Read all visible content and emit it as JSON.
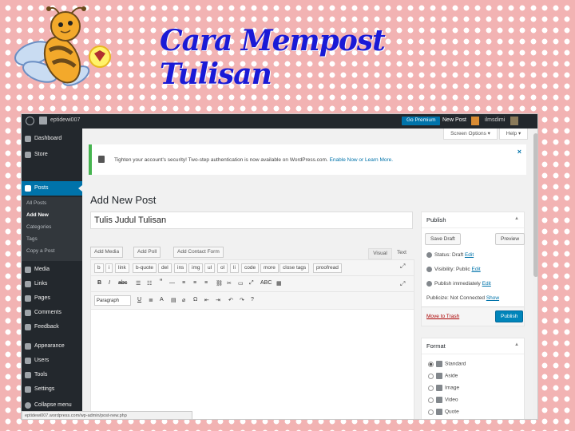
{
  "slide": {
    "title": "Cara Mempost Tulisan"
  },
  "admin_bar": {
    "site_name": "eptidewi007",
    "premium_label": "Go Premium",
    "new_post": "New Post",
    "user": "ilmsdimi"
  },
  "sidebar": {
    "items": [
      {
        "label": "Dashboard",
        "icon": "dashboard-icon"
      },
      {
        "label": "Store",
        "icon": "cart-icon"
      },
      {
        "label": "Posts",
        "icon": "pin-icon"
      },
      {
        "label": "Media",
        "icon": "media-icon"
      },
      {
        "label": "Links",
        "icon": "link-icon"
      },
      {
        "label": "Pages",
        "icon": "pages-icon"
      },
      {
        "label": "Comments",
        "icon": "comment-icon"
      },
      {
        "label": "Feedback",
        "icon": "feedback-icon"
      },
      {
        "label": "Appearance",
        "icon": "brush-icon"
      },
      {
        "label": "Users",
        "icon": "users-icon"
      },
      {
        "label": "Tools",
        "icon": "wrench-icon"
      },
      {
        "label": "Settings",
        "icon": "settings-icon"
      },
      {
        "label": "Collapse menu",
        "icon": "collapse-icon"
      }
    ],
    "posts_submenu": [
      "All Posts",
      "Add New",
      "Categories",
      "Tags",
      "Copy a Post"
    ]
  },
  "screen_options": "Screen Options ▾",
  "help": "Help ▾",
  "notice": {
    "text": "Tighten your account's security! Two-step authentication is now available on WordPress.com.",
    "link": "Enable Now or Learn More."
  },
  "page": {
    "heading": "Add New Post",
    "post_title": "Tulis Judul Tulisan"
  },
  "editor": {
    "add_media": "Add Media",
    "add_poll": "Add Poll",
    "add_contact_form": "Add Contact Form",
    "visual_tab": "Visual",
    "text_tab": "Text",
    "quicktags": [
      "b",
      "i",
      "link",
      "b-quote",
      "del",
      "ins",
      "img",
      "ul",
      "ol",
      "li",
      "code",
      "more",
      "close tags",
      "proofread"
    ],
    "format_select": "Paragraph"
  },
  "publish_box": {
    "title": "Publish",
    "save_draft": "Save Draft",
    "preview": "Preview",
    "status_label": "Status: Draft",
    "visibility_label": "Visibility: Public",
    "publish_label": "Publish immediately",
    "publicize_label": "Publicize: Not Connected",
    "edit": "Edit",
    "show": "Show",
    "move_to_trash": "Move to Trash",
    "publish_button": "Publish"
  },
  "format_box": {
    "title": "Format",
    "options": [
      "Standard",
      "Aside",
      "Image",
      "Video",
      "Quote"
    ],
    "selected": "Standard"
  },
  "status_url": "eptidewi007.wordpress.com/wp-admin/post-new.php"
}
